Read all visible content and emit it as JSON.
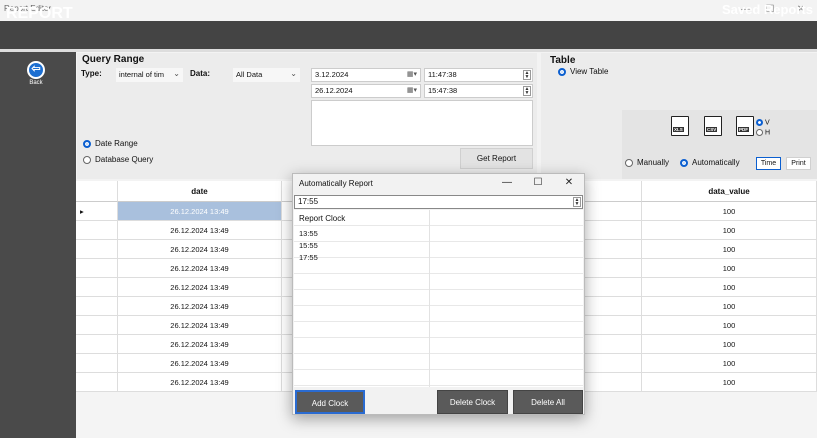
{
  "window": {
    "title": "Report Editor",
    "minimize": "—",
    "maximize": "☐",
    "close": "✕"
  },
  "header": {
    "title": "REPORT",
    "saved_reports": "Saved Reports"
  },
  "sidebar": {
    "back_label": "Back"
  },
  "query": {
    "title": "Query Range",
    "type_label": "Type:",
    "type_value": "internal of tim",
    "data_label": "Data:",
    "data_value": "All Data",
    "start_date": "3.12.2024",
    "end_date": "26.12.2024",
    "start_time": "11:47:38",
    "end_time": "15:47:38",
    "radio_date_range": "Date Range",
    "radio_database_query": "Database Query",
    "get_report": "Get Report"
  },
  "table_panel": {
    "title": "Table",
    "view_table": "View Table",
    "icons": [
      "XLS",
      "CSV",
      "PDF"
    ],
    "orient_v": "V",
    "orient_h": "H",
    "manually": "Manually",
    "automatically": "Automatically",
    "time_btn": "Time",
    "print_btn": "Print"
  },
  "grid": {
    "columns": [
      "date",
      "data_value"
    ],
    "rows": [
      {
        "date": "26.12.2024 13:49",
        "value": "100"
      },
      {
        "date": "26.12.2024 13:49",
        "value": "100"
      },
      {
        "date": "26.12.2024 13:49",
        "value": "100"
      },
      {
        "date": "26.12.2024 13:49",
        "value": "100"
      },
      {
        "date": "26.12.2024 13:49",
        "value": "100"
      },
      {
        "date": "26.12.2024 13:49",
        "value": "100"
      },
      {
        "date": "26.12.2024 13:49",
        "value": "100"
      },
      {
        "date": "26.12.2024 13:49",
        "value": "100"
      },
      {
        "date": "26.12.2024 13:49",
        "value": "100"
      },
      {
        "date": "26.12.2024 13:49",
        "value": "100"
      }
    ],
    "row_indicator": "▸"
  },
  "dialog": {
    "title": "Automatically Report",
    "minimize": "—",
    "maximize": "☐",
    "close": "✕",
    "input_value": "17:55",
    "list_header": "Report Clock",
    "clocks": [
      "13:55",
      "15:55",
      "17:55"
    ],
    "add_clock": "Add Clock",
    "delete_clock": "Delete Clock",
    "delete_all": "Delete All"
  },
  "colors": {
    "accent": "#0b5fd0",
    "header": "#444444",
    "selected_row": "#a9c0dd"
  }
}
